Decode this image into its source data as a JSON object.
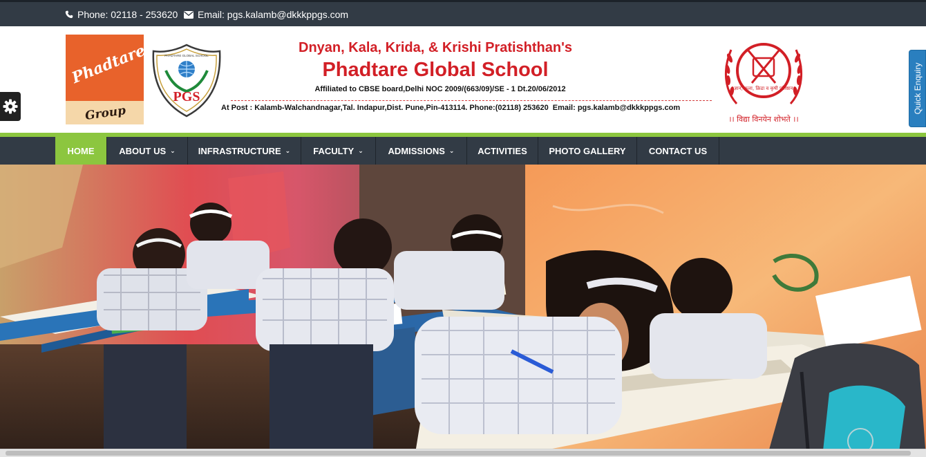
{
  "topbar": {
    "phone_icon": "phone-icon",
    "phone": "Phone: 02118 - 253620",
    "email_icon": "envelope-icon",
    "email": "Email: pgs.kalamb@dkkkppgs.com"
  },
  "header": {
    "group_logo_text": "Phadtare",
    "group_logo_sub": "Group",
    "pgs_logo_text": "PGS",
    "pgs_logo_ring": "PHADTARE GLOBAL SCHOOL",
    "trust_name": "Dnyan, Kala, Krida, & Krishi Pratishthan's",
    "school_name": "Phadtare Global School",
    "affiliation": "Affiliated to CBSE board,Delhi NOC 2009/(663/09)/SE - 1 Dt.20/06/2012",
    "address": "At Post : Kalamb-Walchandnagar,Tal. Indapur,Dist. Pune,Pin-413114. Phone:(02118)  253620",
    "address_email": "Email: pgs.kalamb@dkkkppgs.com",
    "emblem_text": "ज्ञान, कला, क्रिडा व कृषी प्रतिष्ठान",
    "motto": "।। विद्या विनयेन शोभते ।।"
  },
  "quick_enquiry": "Quick Enquiry",
  "nav": {
    "items": [
      {
        "label": "HOME",
        "dropdown": false,
        "active": true
      },
      {
        "label": "ABOUT US",
        "dropdown": true,
        "active": false
      },
      {
        "label": "INFRASTRUCTURE",
        "dropdown": true,
        "active": false
      },
      {
        "label": "FACULTY",
        "dropdown": true,
        "active": false
      },
      {
        "label": "ADMISSIONS",
        "dropdown": true,
        "active": false
      },
      {
        "label": "ACTIVITIES",
        "dropdown": false,
        "active": false
      },
      {
        "label": "PHOTO GALLERY",
        "dropdown": false,
        "active": false
      },
      {
        "label": "CONTACT US",
        "dropdown": false,
        "active": false
      }
    ],
    "caret": "⌄"
  },
  "colors": {
    "topbar_bg": "#323b45",
    "accent_green": "#8cc63f",
    "title_red": "#d21f26",
    "enquiry_blue": "#2a7fbf"
  }
}
